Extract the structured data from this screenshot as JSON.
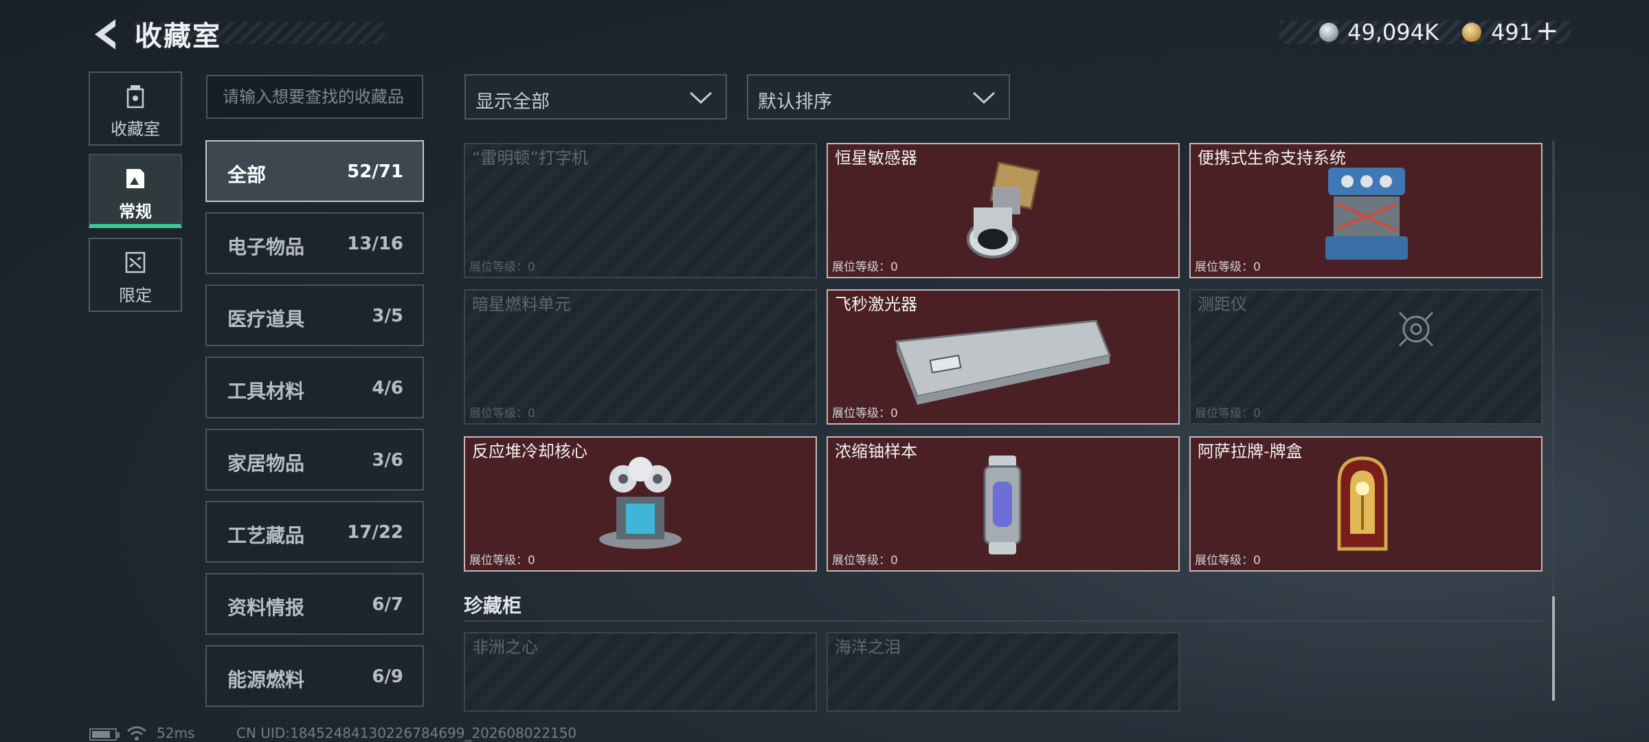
{
  "header": {
    "title": "收藏室"
  },
  "currency": {
    "silver": "49,094K",
    "gold": "491",
    "add_label": "+"
  },
  "nav": {
    "tabs": [
      {
        "label": "收藏室"
      },
      {
        "label": "常规"
      },
      {
        "label": "限定"
      }
    ],
    "active": "常规"
  },
  "search": {
    "placeholder": "请输入想要查找的收藏品"
  },
  "filters": {
    "show": "显示全部",
    "sort": "默认排序"
  },
  "categories": [
    {
      "name": "全部",
      "count": "52/71"
    },
    {
      "name": "电子物品",
      "count": "13/16"
    },
    {
      "name": "医疗道具",
      "count": "3/5"
    },
    {
      "name": "工具材料",
      "count": "4/6"
    },
    {
      "name": "家居物品",
      "count": "3/6"
    },
    {
      "name": "工艺藏品",
      "count": "17/22"
    },
    {
      "name": "资料情报",
      "count": "6/7"
    },
    {
      "name": "能源燃料",
      "count": "6/9"
    }
  ],
  "items": [
    {
      "name": "“雷明顿”打字机",
      "level": "展位等级：0",
      "owned": false
    },
    {
      "name": "恒星敏感器",
      "level": "展位等级：0",
      "owned": true
    },
    {
      "name": "便携式生命支持系统",
      "level": "展位等级：0",
      "owned": true
    },
    {
      "name": "暗星燃料单元",
      "level": "展位等级：0",
      "owned": false
    },
    {
      "name": "飞秒激光器",
      "level": "展位等级：0",
      "owned": true
    },
    {
      "name": "测距仪",
      "level": "展位等级：0",
      "owned": false
    },
    {
      "name": "反应堆冷却核心",
      "level": "展位等级：0",
      "owned": true
    },
    {
      "name": "浓缩铀样本",
      "level": "展位等级：0",
      "owned": true
    },
    {
      "name": "阿萨拉牌-牌盒",
      "level": "展位等级：0",
      "owned": true
    }
  ],
  "cabinet": {
    "title": "珍藏柜",
    "items": [
      {
        "name": "非洲之心",
        "owned": false
      },
      {
        "name": "海洋之泪",
        "owned": false
      }
    ]
  },
  "footer": {
    "ping": "52ms",
    "uid": "CN UID:18452484130226784699_202608022150"
  },
  "colors": {
    "owned_bg": "#4a2024",
    "active_tab_accent": "#3cc88f",
    "background": "#1e262e"
  }
}
